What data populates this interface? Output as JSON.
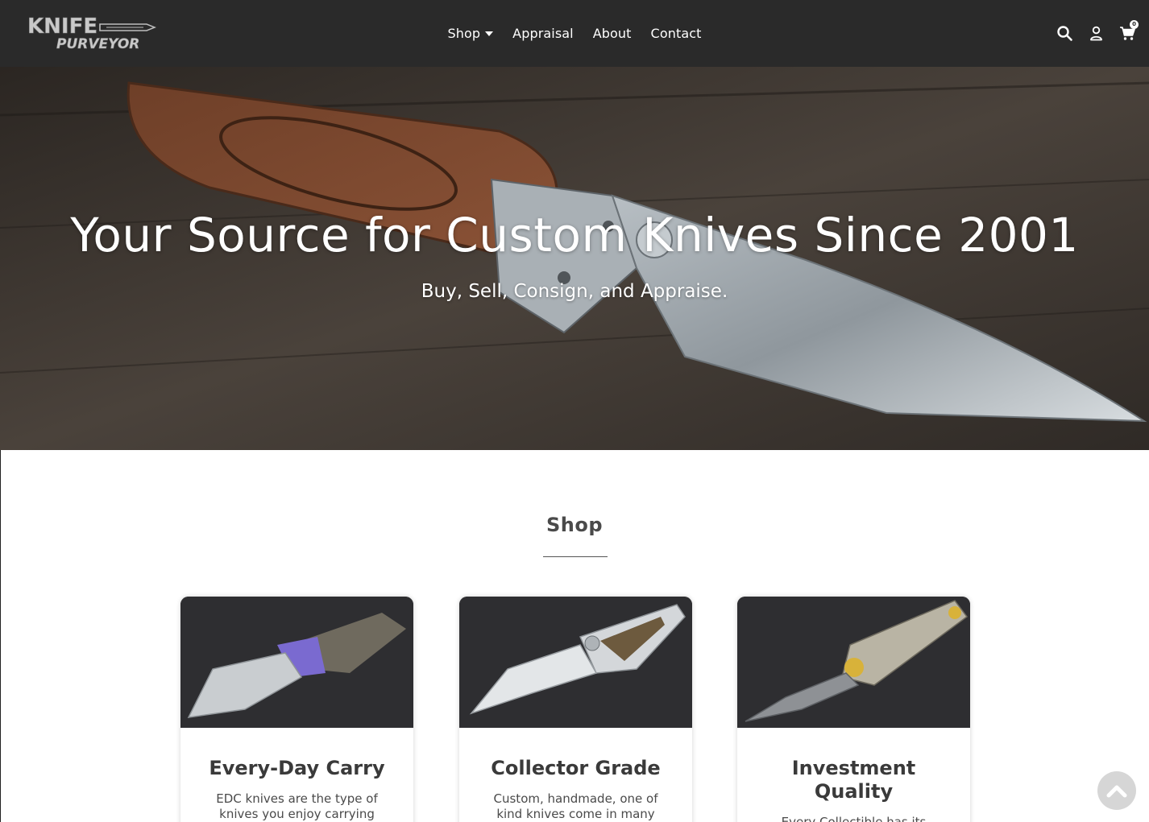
{
  "brand": {
    "logo_text_top": "KNIFE",
    "logo_text_bottom": "PURVEYOR"
  },
  "nav": {
    "items": [
      {
        "label": "Shop",
        "has_dropdown": true
      },
      {
        "label": "Appraisal"
      },
      {
        "label": "About"
      },
      {
        "label": "Contact"
      }
    ]
  },
  "header_icons": {
    "search": "search-icon",
    "account": "user-icon",
    "cart": "cart-icon",
    "cart_count": "0"
  },
  "hero": {
    "title": "Your Source for Custom Knives Since 2001",
    "subtitle": "Buy, Sell, Consign, and Appraise."
  },
  "shop": {
    "title": "Shop",
    "cards": [
      {
        "title": "Every-Day Carry",
        "text": "EDC knives are the type of knives you enjoy carrying"
      },
      {
        "title": "Collector Grade",
        "text": "Custom, handmade, one of kind knives come in many"
      },
      {
        "title": "Investment Quality",
        "text": "Every Collectible has its"
      }
    ]
  },
  "colors": {
    "header_bg": "#2a2a2a",
    "text": "#3a3a3a",
    "card_image_bg": "#2d2d30"
  }
}
